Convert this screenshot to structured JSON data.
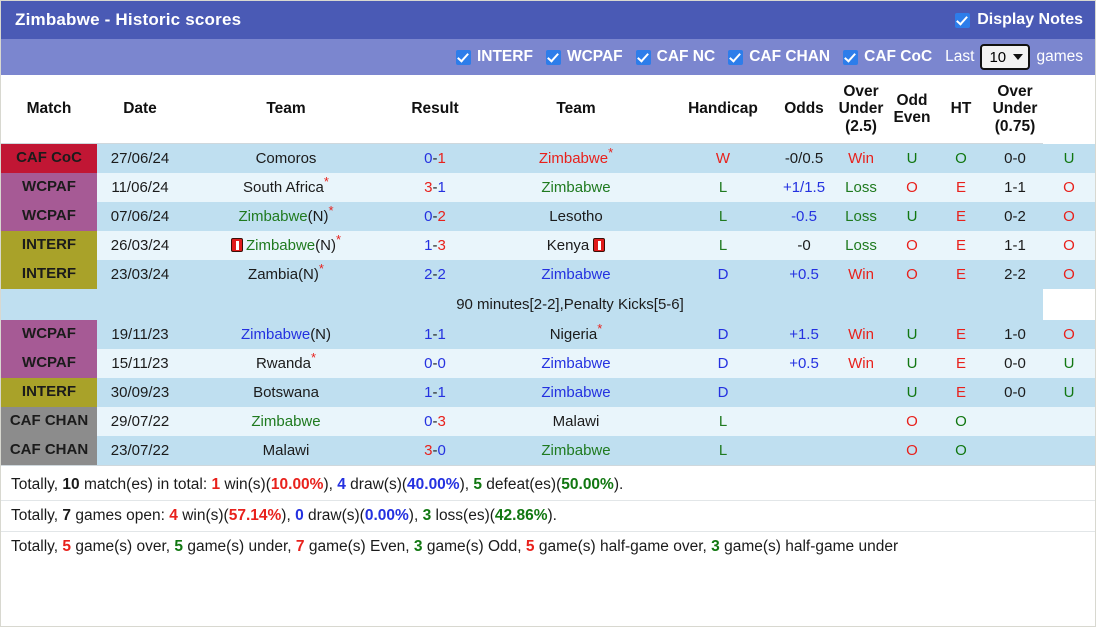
{
  "header": {
    "title": "Zimbabwe - Historic scores",
    "display_notes_label": "Display Notes",
    "display_notes_checked": true
  },
  "filters": {
    "items": [
      {
        "label": "INTERF",
        "checked": true
      },
      {
        "label": "WCPAF",
        "checked": true
      },
      {
        "label": "CAF NC",
        "checked": true
      },
      {
        "label": "CAF CHAN",
        "checked": true
      },
      {
        "label": "CAF CoC",
        "checked": true
      }
    ],
    "last_label": "Last",
    "games_count": "10",
    "games_label": "games"
  },
  "table": {
    "columns": [
      "Match",
      "Date",
      "Team",
      "Result",
      "Team",
      "Handicap",
      "Odds",
      "Over Under (2.5)",
      "Odd Even",
      "HT",
      "Over Under (0.75)"
    ],
    "col_over_under_25": {
      "l1": "Over",
      "l2": "Under",
      "l3": "(2.5)"
    },
    "col_odd_even": {
      "l1": "Odd",
      "l2": "Even"
    },
    "col_over_under_075": {
      "l1": "Over",
      "l2": "Under",
      "l3": "(0.75)"
    },
    "rows": [
      {
        "comp": "CAF CoC",
        "comp_class": "b-cafcoc",
        "date": "27/06/24",
        "home": "Comoros",
        "home_color": "c-black",
        "home_star": false,
        "home_card": false,
        "score_a": "0",
        "score_a_color": "c-blue",
        "score_b": "1",
        "score_b_color": "c-red",
        "away": "Zimbabwe",
        "away_color": "c-red",
        "away_star": true,
        "away_card": false,
        "wld": "W",
        "wld_color": "c-red",
        "handicap": "-0/0.5",
        "handicap_color": "c-black",
        "odds": "Win",
        "odds_color": "c-red",
        "ou25": "U",
        "ou25_color": "c-dgreen",
        "oddeven": "O",
        "oddeven_color": "c-dgreen",
        "ht": "0-0",
        "ou075": "U",
        "ou075_color": "c-dgreen"
      },
      {
        "comp": "WCPAF",
        "comp_class": "b-wcpaf",
        "date": "11/06/24",
        "home": "South Africa",
        "home_color": "c-black",
        "home_star": true,
        "home_card": false,
        "score_a": "3",
        "score_a_color": "c-red",
        "score_b": "1",
        "score_b_color": "c-blue",
        "away": "Zimbabwe",
        "away_color": "c-green",
        "away_star": false,
        "away_card": false,
        "wld": "L",
        "wld_color": "c-green",
        "handicap": "+1/1.5",
        "handicap_color": "c-blue",
        "odds": "Loss",
        "odds_color": "c-green",
        "ou25": "O",
        "ou25_color": "c-red",
        "oddeven": "E",
        "oddeven_color": "c-red",
        "ht": "1-1",
        "ou075": "O",
        "ou075_color": "c-red"
      },
      {
        "comp": "WCPAF",
        "comp_class": "b-wcpaf",
        "date": "07/06/24",
        "home": "Zimbabwe",
        "home_color": "c-green",
        "home_suffix": "(N)",
        "home_star": true,
        "home_card": false,
        "score_a": "0",
        "score_a_color": "c-blue",
        "score_b": "2",
        "score_b_color": "c-red",
        "away": "Lesotho",
        "away_color": "c-black",
        "away_star": false,
        "away_card": false,
        "wld": "L",
        "wld_color": "c-green",
        "handicap": "-0.5",
        "handicap_color": "c-blue",
        "odds": "Loss",
        "odds_color": "c-green",
        "ou25": "U",
        "ou25_color": "c-dgreen",
        "oddeven": "E",
        "oddeven_color": "c-red",
        "ht": "0-2",
        "ou075": "O",
        "ou075_color": "c-red"
      },
      {
        "comp": "INTERF",
        "comp_class": "b-interf",
        "date": "26/03/24",
        "home": "Zimbabwe",
        "home_color": "c-green",
        "home_suffix": "(N)",
        "home_star": true,
        "home_card": true,
        "score_a": "1",
        "score_a_color": "c-blue",
        "score_b": "3",
        "score_b_color": "c-red",
        "away": "Kenya",
        "away_color": "c-black",
        "away_star": false,
        "away_card_after": true,
        "wld": "L",
        "wld_color": "c-green",
        "handicap": "-0",
        "handicap_color": "c-black",
        "odds": "Loss",
        "odds_color": "c-green",
        "ou25": "O",
        "ou25_color": "c-red",
        "oddeven": "E",
        "oddeven_color": "c-red",
        "ht": "1-1",
        "ou075": "O",
        "ou075_color": "c-red"
      },
      {
        "comp": "INTERF",
        "comp_class": "b-interf",
        "date": "23/03/24",
        "home": "Zambia",
        "home_color": "c-black",
        "home_suffix": "(N)",
        "home_star": true,
        "home_card": false,
        "score_a": "2",
        "score_a_color": "c-blue",
        "score_b": "2",
        "score_b_color": "c-blue",
        "away": "Zimbabwe",
        "away_color": "c-blue",
        "away_star": false,
        "away_card": false,
        "wld": "D",
        "wld_color": "c-blue",
        "handicap": "+0.5",
        "handicap_color": "c-blue",
        "odds": "Win",
        "odds_color": "c-red",
        "ou25": "O",
        "ou25_color": "c-red",
        "oddeven": "E",
        "oddeven_color": "c-red",
        "ht": "2-2",
        "ou075": "O",
        "ou075_color": "c-red",
        "note": "90 minutes[2-2],Penalty Kicks[5-6]"
      },
      {
        "comp": "WCPAF",
        "comp_class": "b-wcpaf",
        "date": "19/11/23",
        "home": "Zimbabwe",
        "home_color": "c-blue",
        "home_suffix": "(N)",
        "home_star": false,
        "home_card": false,
        "score_a": "1",
        "score_a_color": "c-blue",
        "score_b": "1",
        "score_b_color": "c-blue",
        "away": "Nigeria",
        "away_color": "c-black",
        "away_star": true,
        "away_card": false,
        "wld": "D",
        "wld_color": "c-blue",
        "handicap": "+1.5",
        "handicap_color": "c-blue",
        "odds": "Win",
        "odds_color": "c-red",
        "ou25": "U",
        "ou25_color": "c-dgreen",
        "oddeven": "E",
        "oddeven_color": "c-red",
        "ht": "1-0",
        "ou075": "O",
        "ou075_color": "c-red"
      },
      {
        "comp": "WCPAF",
        "comp_class": "b-wcpaf",
        "date": "15/11/23",
        "home": "Rwanda",
        "home_color": "c-black",
        "home_star": true,
        "home_card": false,
        "score_a": "0",
        "score_a_color": "c-blue",
        "score_b": "0",
        "score_b_color": "c-blue",
        "away": "Zimbabwe",
        "away_color": "c-blue",
        "away_star": false,
        "away_card": false,
        "wld": "D",
        "wld_color": "c-blue",
        "handicap": "+0.5",
        "handicap_color": "c-blue",
        "odds": "Win",
        "odds_color": "c-red",
        "ou25": "U",
        "ou25_color": "c-dgreen",
        "oddeven": "E",
        "oddeven_color": "c-red",
        "ht": "0-0",
        "ou075": "U",
        "ou075_color": "c-dgreen"
      },
      {
        "comp": "INTERF",
        "comp_class": "b-interf",
        "date": "30/09/23",
        "home": "Botswana",
        "home_color": "c-black",
        "home_star": false,
        "home_card": false,
        "score_a": "1",
        "score_a_color": "c-blue",
        "score_b": "1",
        "score_b_color": "c-blue",
        "away": "Zimbabwe",
        "away_color": "c-blue",
        "away_star": false,
        "away_card": false,
        "wld": "D",
        "wld_color": "c-blue",
        "handicap": "",
        "handicap_color": "c-black",
        "odds": "",
        "odds_color": "c-black",
        "ou25": "U",
        "ou25_color": "c-dgreen",
        "oddeven": "E",
        "oddeven_color": "c-red",
        "ht": "0-0",
        "ou075": "U",
        "ou075_color": "c-dgreen"
      },
      {
        "comp": "CAF CHAN",
        "comp_class": "b-cafchan",
        "date": "29/07/22",
        "home": "Zimbabwe",
        "home_color": "c-green",
        "home_star": false,
        "home_card": false,
        "score_a": "0",
        "score_a_color": "c-blue",
        "score_b": "3",
        "score_b_color": "c-red",
        "away": "Malawi",
        "away_color": "c-black",
        "away_star": false,
        "away_card": false,
        "wld": "L",
        "wld_color": "c-green",
        "handicap": "",
        "handicap_color": "c-black",
        "odds": "",
        "odds_color": "c-black",
        "ou25": "O",
        "ou25_color": "c-red",
        "oddeven": "O",
        "oddeven_color": "c-dgreen",
        "ht": "",
        "ou075": "",
        "ou075_color": "c-black"
      },
      {
        "comp": "CAF CHAN",
        "comp_class": "b-cafchan",
        "date": "23/07/22",
        "home": "Malawi",
        "home_color": "c-black",
        "home_star": false,
        "home_card": false,
        "score_a": "3",
        "score_a_color": "c-red",
        "score_b": "0",
        "score_b_color": "c-blue",
        "away": "Zimbabwe",
        "away_color": "c-green",
        "away_star": false,
        "away_card": false,
        "wld": "L",
        "wld_color": "c-green",
        "handicap": "",
        "handicap_color": "c-black",
        "odds": "",
        "odds_color": "c-black",
        "ou25": "O",
        "ou25_color": "c-red",
        "oddeven": "O",
        "oddeven_color": "c-dgreen",
        "ht": "",
        "ou075": "",
        "ou075_color": "c-black"
      }
    ]
  },
  "summary": {
    "line1": [
      {
        "t": "Totally, ",
        "c": "c-black",
        "b": false
      },
      {
        "t": "10",
        "c": "c-black",
        "b": true
      },
      {
        "t": " match(es) in total: ",
        "c": "c-black",
        "b": false
      },
      {
        "t": "1",
        "c": "c-red",
        "b": true
      },
      {
        "t": " win(s)(",
        "c": "c-black",
        "b": false
      },
      {
        "t": "10.00%",
        "c": "c-red",
        "b": true
      },
      {
        "t": "), ",
        "c": "c-black",
        "b": false
      },
      {
        "t": "4",
        "c": "c-blue",
        "b": true
      },
      {
        "t": " draw(s)(",
        "c": "c-black",
        "b": false
      },
      {
        "t": "40.00%",
        "c": "c-blue",
        "b": true
      },
      {
        "t": "), ",
        "c": "c-black",
        "b": false
      },
      {
        "t": "5",
        "c": "c-dgreen",
        "b": true
      },
      {
        "t": " defeat(es)(",
        "c": "c-black",
        "b": false
      },
      {
        "t": "50.00%",
        "c": "c-dgreen",
        "b": true
      },
      {
        "t": ").",
        "c": "c-black",
        "b": false
      }
    ],
    "line2": [
      {
        "t": "Totally, ",
        "c": "c-black",
        "b": false
      },
      {
        "t": "7",
        "c": "c-black",
        "b": true
      },
      {
        "t": " games open: ",
        "c": "c-black",
        "b": false
      },
      {
        "t": "4",
        "c": "c-red",
        "b": true
      },
      {
        "t": " win(s)(",
        "c": "c-black",
        "b": false
      },
      {
        "t": "57.14%",
        "c": "c-red",
        "b": true
      },
      {
        "t": "), ",
        "c": "c-black",
        "b": false
      },
      {
        "t": "0",
        "c": "c-blue",
        "b": true
      },
      {
        "t": " draw(s)(",
        "c": "c-black",
        "b": false
      },
      {
        "t": "0.00%",
        "c": "c-blue",
        "b": true
      },
      {
        "t": "), ",
        "c": "c-black",
        "b": false
      },
      {
        "t": "3",
        "c": "c-dgreen",
        "b": true
      },
      {
        "t": " loss(es)(",
        "c": "c-black",
        "b": false
      },
      {
        "t": "42.86%",
        "c": "c-dgreen",
        "b": true
      },
      {
        "t": ").",
        "c": "c-black",
        "b": false
      }
    ],
    "line3": [
      {
        "t": "Totally, ",
        "c": "c-black",
        "b": false
      },
      {
        "t": "5",
        "c": "c-red",
        "b": true
      },
      {
        "t": " game(s) over, ",
        "c": "c-black",
        "b": false
      },
      {
        "t": "5",
        "c": "c-dgreen",
        "b": true
      },
      {
        "t": " game(s) under, ",
        "c": "c-black",
        "b": false
      },
      {
        "t": "7",
        "c": "c-red",
        "b": true
      },
      {
        "t": " game(s) Even, ",
        "c": "c-black",
        "b": false
      },
      {
        "t": "3",
        "c": "c-dgreen",
        "b": true
      },
      {
        "t": " game(s) Odd, ",
        "c": "c-black",
        "b": false
      },
      {
        "t": "5",
        "c": "c-red",
        "b": true
      },
      {
        "t": " game(s) half-game over, ",
        "c": "c-black",
        "b": false
      },
      {
        "t": "3",
        "c": "c-dgreen",
        "b": true
      },
      {
        "t": " game(s) half-game under",
        "c": "c-black",
        "b": false
      }
    ]
  }
}
